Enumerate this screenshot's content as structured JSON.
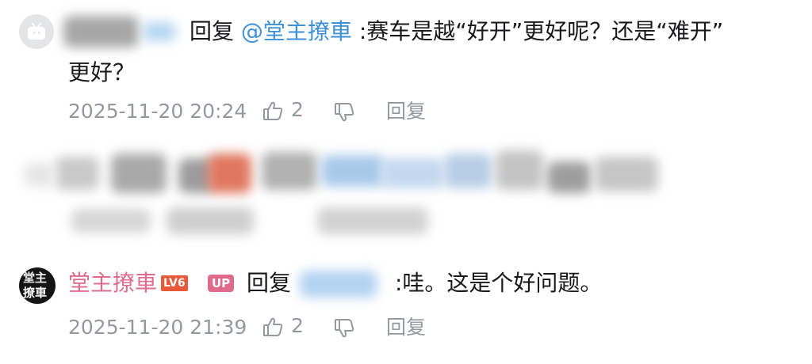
{
  "comments": [
    {
      "reply_label": "回复",
      "mention": "@堂主撩車",
      "text_line1": ":赛车是越“好开”更好呢？还是“难开”",
      "text_line2": "更好？",
      "timestamp": "2025-11-20 20:24",
      "like_count": "2",
      "reply_button": "回复",
      "avatar_icon": "bilibili-tv-icon"
    },
    {
      "username": "堂主撩車",
      "level_badge": "LV6",
      "up_badge": "UP",
      "reply_label": "回复",
      "text": ":哇。这是个好问题。",
      "timestamp": "2025-11-20 21:39",
      "like_count": "2",
      "reply_button": "回复",
      "avatar_text": "堂主撩車"
    }
  ],
  "colors": {
    "mention": "#3d8fd8",
    "username": "#e06b8c",
    "meta": "#9499a0",
    "up_badge": "#e06b8c"
  }
}
